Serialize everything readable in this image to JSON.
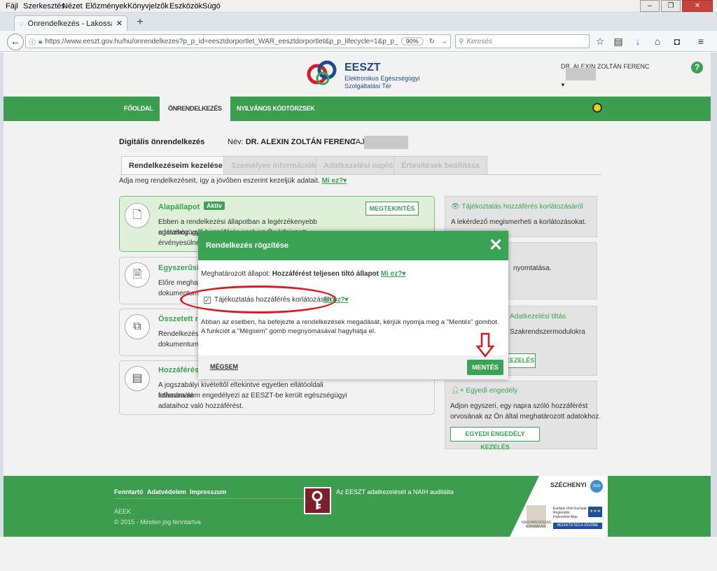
{
  "browser": {
    "menu": [
      "Fájl",
      "Szerkesztés",
      "Nézet",
      "Előzmények",
      "Könyvjelzők",
      "Eszközök",
      "Súgó"
    ],
    "tab_title": "Önrendelkezés - Lakossági P...",
    "url": "https://www.eeszt.gov.hu/hu/onrendelkezes?p_p_id=eesztdorportlet_WAR_eesztdorportlet&p_p_lifecycle=1&p_p_sta",
    "zoom": "90%",
    "search_placeholder": "Keresés"
  },
  "header": {
    "logo_title": "EESZT",
    "logo_sub1": "Elektronikus Egészségügyi",
    "logo_sub2": "Szolgáltatási Tér",
    "username": "DR. ALEXIN ZOLTÁN FERENC",
    "help": "?"
  },
  "nav": {
    "items": [
      "FŐOLDAL",
      "ÖNRENDELKEZÉS",
      "NYILVÁNOS KÓDTÖRZSEK"
    ]
  },
  "main": {
    "title": "Digitális önrendelkezés",
    "name_label": "Név:",
    "name_value": "DR. ALEXIN ZOLTÁN FERENC",
    "taj_label": "TAJ",
    "tabs": [
      "Rendelkezéseim kezelése",
      "Személyes információk",
      "Adatkezelési napló",
      "Értesítések beállítása"
    ],
    "intro": "Adja meg rendelkezéseit, így a jövőben eszerint kezeljük adatait.",
    "intro_link": "Mi ez?▾",
    "cards": [
      {
        "title": "Alapállapot",
        "badge": "Aktív",
        "button": "MEGTEKINTÉS",
        "line1": "Ebben a rendelkezési állapotban a legérzékenyebb egészségügyi",
        "line2": "adataihoz való hozzáférés csak az Ön kifejezett",
        "line3": "érvényesülnek."
      },
      {
        "title": "Egyszerűsített",
        "line1": "Előre meghatározott",
        "line2": "dokumentumokhoz"
      },
      {
        "title": "Összetett rendelkezés",
        "line1": "Rendelkezése",
        "line2": "dokumentumok"
      },
      {
        "title": "Hozzáférést tiltó",
        "line1": "A jogszabályi kivételtől eltekintve egyetlen ellátóoldali felhasználó",
        "line2": "számára sem engedélyezi az EESZT-be került egészségügyi",
        "line3": "adataihoz való hozzáférést."
      }
    ],
    "right": [
      {
        "title": "Tájékoztatás hozzáférés korlátozásáról",
        "text": "A lekérdező megismerheti a korlátozásokat."
      },
      {
        "text": "nyomtatása."
      },
      {
        "title": "Adatkezelési tiltás",
        "text": "Szakrendszermodulokra",
        "button": "KEZELÉS"
      },
      {
        "title": "Egyedi engedély",
        "text1": "Adjon egyszeri, egy napra szóló hozzáférést",
        "text2": "orvosának az Ön által meghatározott adatokhoz.",
        "button": "EGYEDI ENGEDÉLY KEZELÉS"
      }
    ]
  },
  "modal": {
    "title": "Rendelkezés rögzítése",
    "close": "✕",
    "status_prefix": "Meghatározott állapot:",
    "status_value": "Hozzáférést teljesen tiltó állapot",
    "status_link": "Mi ez?▾",
    "checkbox_label": "Tájékoztatás hozzáférés korlátozásáról",
    "checkbox_checked": true,
    "checkbox_link": "Mi ez?▾",
    "para1": "Abban az esetben, ha befejezte a rendelkezések megadását, kérjük nyomja meg a \"Mentés\" gombot.",
    "para2": "A funkciót a \"Mégsem\" gomb megnyomásával hagyhatja el.",
    "cancel": "MÉGSEM",
    "save": "MENTÉS"
  },
  "footer": {
    "links": [
      "Fenntartó",
      "Adatvédelem",
      "Impresszum"
    ],
    "org": "ÁEEK",
    "copyright": "© 2015 - Minden jog fenntartva",
    "naih": "Az EESZT adatkezelését a NAIH auditálta",
    "szechenyi": "SZÉCHENYI",
    "szechenyi_badge": "2020",
    "gov": "MAGYARORSZÁG KORMÁNYA",
    "eu": "Európai Unió Európai Regionális Fejlesztési Alap",
    "invest": "BEFEKTETÉS A JÖVŐBE"
  },
  "colors": {
    "green": "#3aa356",
    "navgreen": "#3c9d4e",
    "red": "#d91c24"
  }
}
